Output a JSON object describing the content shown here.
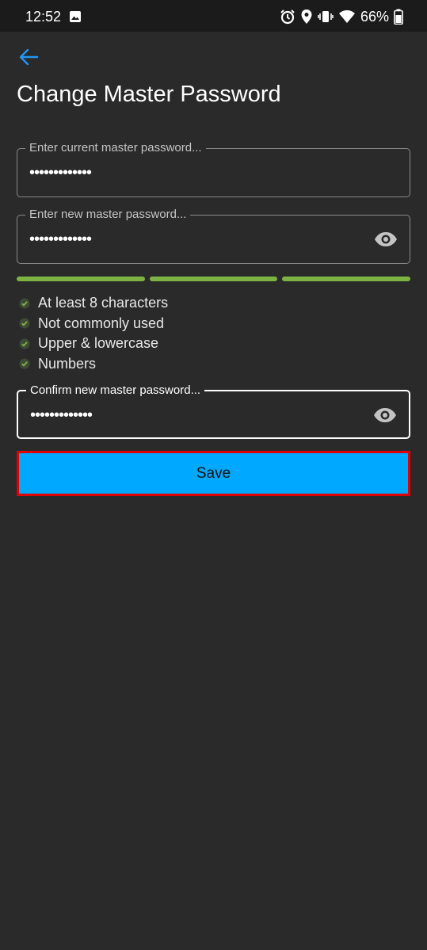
{
  "statusbar": {
    "time": "12:52",
    "battery": "66%",
    "icons": [
      "gallery-icon",
      "alarm-icon",
      "location-icon",
      "vibrate-icon",
      "wifi-icon",
      "battery-icon"
    ]
  },
  "header": {
    "back_icon": "arrow-left-icon",
    "title": "Change Master Password"
  },
  "form": {
    "current": {
      "placeholder": "Enter current master password...",
      "value": "•••••••••••••"
    },
    "new": {
      "placeholder": "Enter new master password...",
      "value": "•••••••••••••"
    },
    "confirm": {
      "placeholder": "Confirm new master password...",
      "value": "•••••••••••••"
    }
  },
  "strength": {
    "segments_filled": 3,
    "segments_total": 3,
    "color": "#7cb342"
  },
  "requirements": [
    {
      "label": "At least 8 characters",
      "met": true
    },
    {
      "label": "Not commonly used",
      "met": true
    },
    {
      "label": "Upper & lowercase",
      "met": true
    },
    {
      "label": "Numbers",
      "met": true
    }
  ],
  "save": {
    "label": "Save",
    "color": "#00a8ff",
    "highlight": "#e00000"
  },
  "colors": {
    "background": "#2a2a2a",
    "accent": "#2196f3",
    "check": "#7cb342"
  }
}
